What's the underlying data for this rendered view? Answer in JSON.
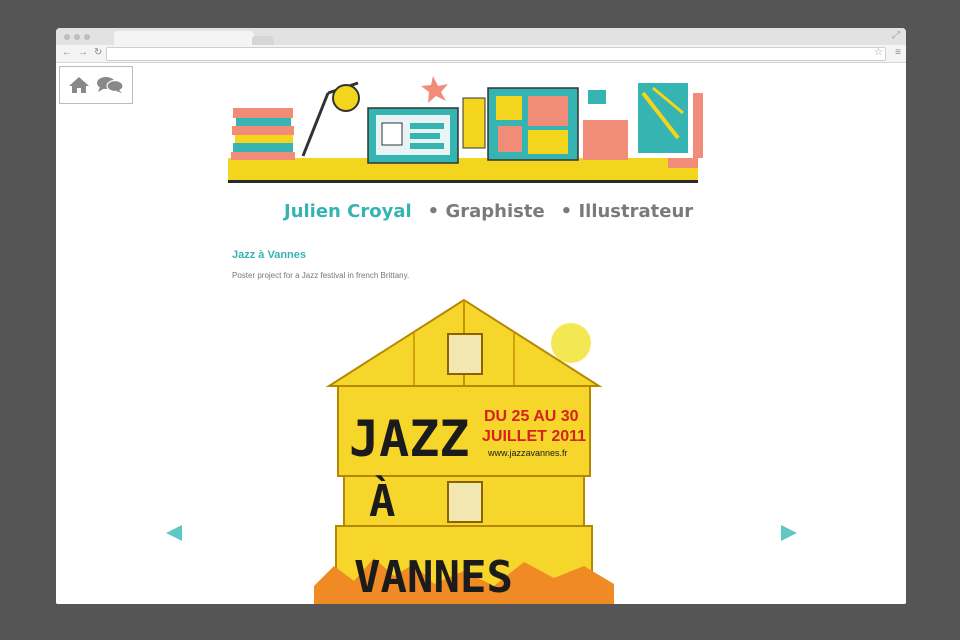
{
  "site": {
    "brand_name": "Julien Croyal",
    "separator": "•",
    "role1": "Graphiste",
    "role2": "Illustrateur"
  },
  "project": {
    "title": "Jazz à Vannes",
    "description": "Poster project for a Jazz festival in french Brittany."
  },
  "poster": {
    "title_line1": "JAZZ",
    "title_line2": "À",
    "title_line3": "VANNES",
    "dates_line1": "DU 25 AU 30",
    "dates_line2": "JUILLET 2011",
    "url": "www.jazzavannes.fr"
  },
  "icons": {
    "home": "home-icon",
    "comments": "comments-icon",
    "prev": "arrow-left-icon",
    "next": "arrow-right-icon"
  },
  "colors": {
    "accent": "#35b4b2",
    "poster_yellow": "#f2d51c",
    "poster_red": "#d6221d"
  }
}
